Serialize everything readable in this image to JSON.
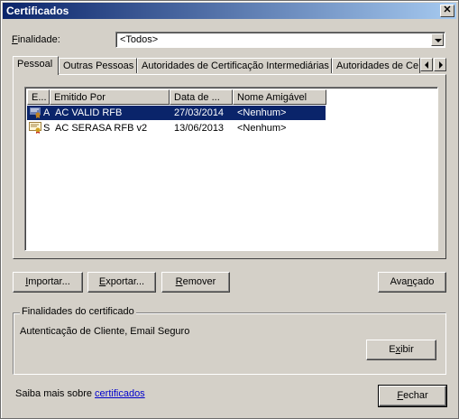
{
  "window": {
    "title": "Certificados",
    "close": "✕"
  },
  "finalidade": {
    "label_prefix": "",
    "label_u": "F",
    "label_rest": "inalidade:",
    "value": "<Todos>"
  },
  "tabs": [
    {
      "label": "Pessoal"
    },
    {
      "label": "Outras Pessoas"
    },
    {
      "label": "Autoridades de Certificação Intermediárias"
    },
    {
      "label": "Autoridades de Ce"
    }
  ],
  "list": {
    "columns": [
      "E...",
      "Emitido Por",
      "Data de ...",
      "Nome Amigável"
    ],
    "rows": [
      {
        "emitido_para": "A",
        "emitido_por": "AC VALID RFB",
        "data": "27/03/2014",
        "nome": "<Nenhum>",
        "selected": true
      },
      {
        "emitido_para": "S",
        "emitido_por": "AC SERASA RFB v2",
        "data": "13/06/2013",
        "nome": "<Nenhum>",
        "selected": false
      }
    ]
  },
  "buttons": {
    "importar": {
      "u": "I",
      "rest": "mportar..."
    },
    "exportar": {
      "u": "E",
      "rest": "xportar..."
    },
    "remover": {
      "u": "R",
      "rest": "emover"
    },
    "avancado": {
      "pre": "Ava",
      "u": "n",
      "rest": "çado"
    },
    "exibir": {
      "pre": "E",
      "u": "x",
      "rest": "ibir"
    },
    "fechar": {
      "u": "F",
      "rest": "echar"
    }
  },
  "group": {
    "title": "Finalidades do certificado",
    "value": "Autenticação de Cliente, Email Seguro"
  },
  "footer": {
    "text": "Saiba mais sobre ",
    "link": "certificados"
  },
  "colors": {
    "titlebar": "#0a246a",
    "selection": "#0a246a",
    "link": "#0000cc"
  }
}
